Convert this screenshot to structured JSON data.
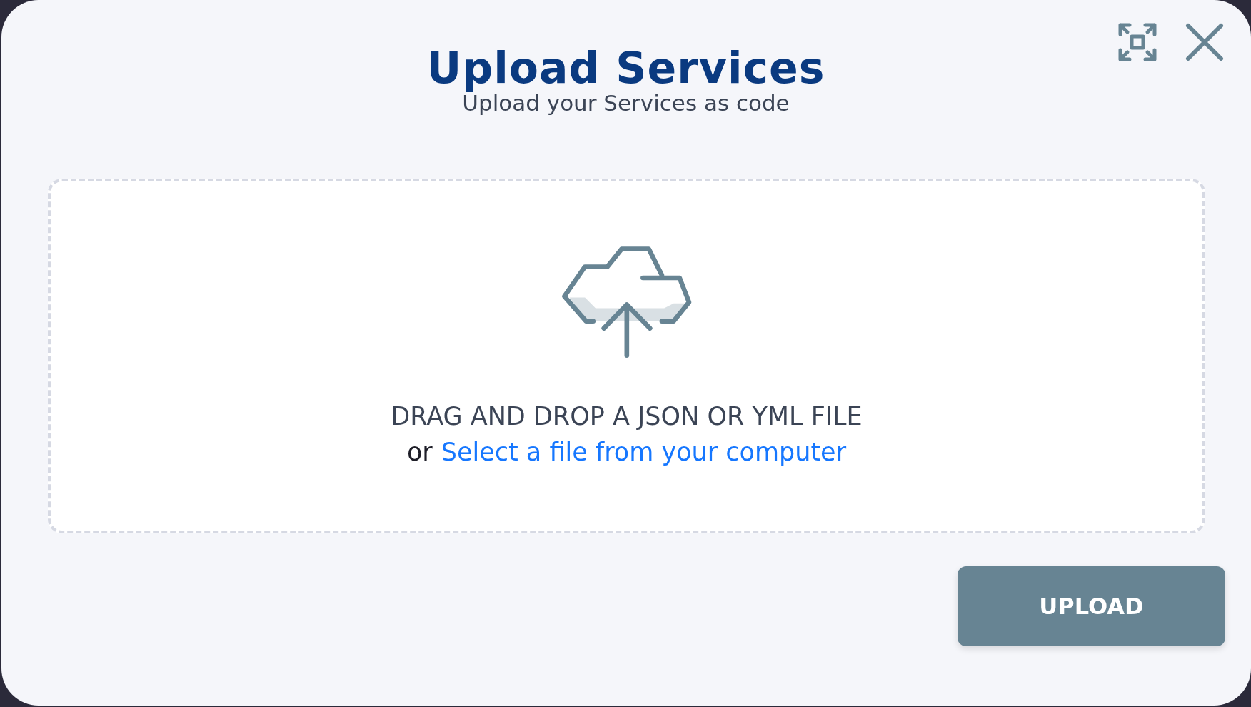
{
  "dialog": {
    "title": "Upload Services",
    "subtitle": "Upload your Services as code"
  },
  "dropzone": {
    "instruction": "DRAG AND DROP A JSON OR YML FILE",
    "prefix": "or",
    "link": "Select a file from your computer"
  },
  "upload_button": {
    "label": "UPLOAD"
  }
}
